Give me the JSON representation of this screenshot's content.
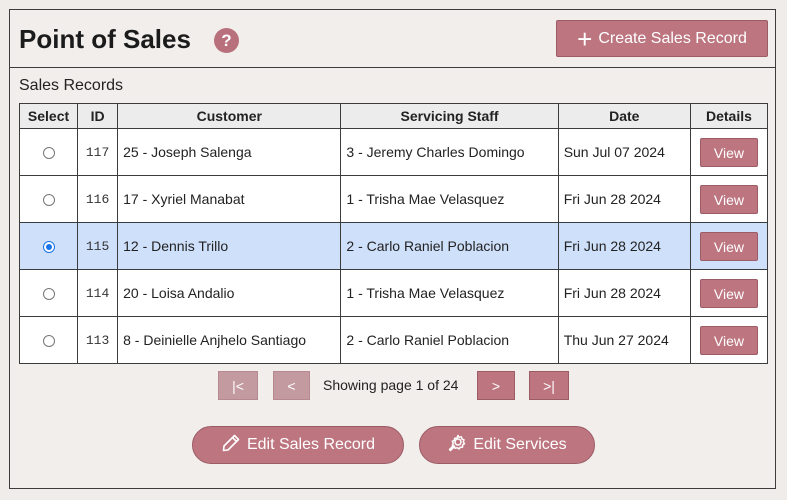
{
  "header": {
    "title": "Point of Sales",
    "help_glyph": "?",
    "create_button": "Create Sales Record",
    "create_icon": "plus-icon"
  },
  "section_title": "Sales Records",
  "table": {
    "columns": [
      "Select",
      "ID",
      "Customer",
      "Servicing Staff",
      "Date",
      "Details"
    ],
    "rows": [
      {
        "id": "117",
        "customer": "25 - Joseph Salenga",
        "staff": "3 - Jeremy Charles Domingo",
        "date": "Sun Jul 07 2024",
        "details": "View",
        "selected": false
      },
      {
        "id": "116",
        "customer": "17 - Xyriel Manabat",
        "staff": "1 - Trisha Mae Velasquez",
        "date": "Fri Jun 28 2024",
        "details": "View",
        "selected": false
      },
      {
        "id": "115",
        "customer": "12 - Dennis Trillo",
        "staff": "2 - Carlo Raniel Poblacion",
        "date": "Fri Jun 28 2024",
        "details": "View",
        "selected": true
      },
      {
        "id": "114",
        "customer": "20 - Loisa Andalio",
        "staff": "1 - Trisha Mae Velasquez",
        "date": "Fri Jun 28 2024",
        "details": "View",
        "selected": false
      },
      {
        "id": "113",
        "customer": "8 - Deinielle Anjhelo Santiago",
        "staff": "2 - Carlo Raniel Poblacion",
        "date": "Thu Jun 27 2024",
        "details": "View",
        "selected": false
      }
    ]
  },
  "pagination": {
    "first": "|<",
    "prev": "<",
    "status": "Showing page 1 of 24",
    "next": ">",
    "last": ">|"
  },
  "actions": {
    "edit_sales_record": "Edit Sales Record",
    "edit_services": "Edit Services"
  },
  "colors": {
    "accent": "#bd7680",
    "accent_disabled": "#c49aa1",
    "selected_row": "#cfe0fb",
    "background": "#f2eeeb"
  }
}
